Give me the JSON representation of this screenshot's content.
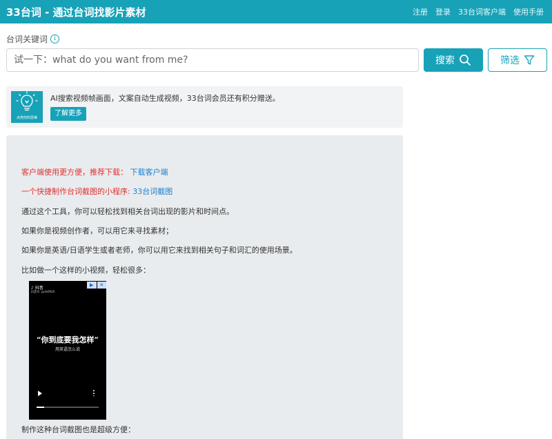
{
  "header": {
    "title": "33台词 - 通过台词找影片素材",
    "nav": [
      "注册",
      "登录",
      "33台词客户端",
      "使用手册"
    ]
  },
  "search": {
    "label": "台词关键词",
    "placeholder": "试一下：what do you want from me?",
    "search_label": "搜索",
    "filter_label": "筛选"
  },
  "ad": {
    "logo_caption": "点亮你的思维",
    "text": "AI搜索视频帧画面，文案自动生成视频，33台词会员还有积分赠送。",
    "more_label": "了解更多"
  },
  "info": {
    "client_prefix": "客户端使用更方便，推荐下载：",
    "client_link": "下载客户端",
    "miniprogram_prefix": "一个快捷制作台词截图的小程序:",
    "miniprogram_link": "33台词截图",
    "line1": "通过这个工具，你可以轻松找到相关台词出现的影片和时间点。",
    "line2": "如果你是视频创作者，可以用它来寻找素材；",
    "line3": "如果你是英语/日语学生或者老师，你可以用它来找到相关句子和词汇的使用场景。",
    "line4": "比如做一个这样的小视频，轻松很多：",
    "line5": "制作这种台词截图也是超级方便："
  },
  "video": {
    "app_label": "抖音",
    "account_id": "抖音号: yyds0920",
    "title": "“你到底要我怎样”",
    "subtitle": "用英语怎么说",
    "progress": 0.12
  },
  "colors": {
    "brand": "#17a2b8",
    "link_red": "#e03030",
    "link_blue": "#1a7fcf"
  }
}
